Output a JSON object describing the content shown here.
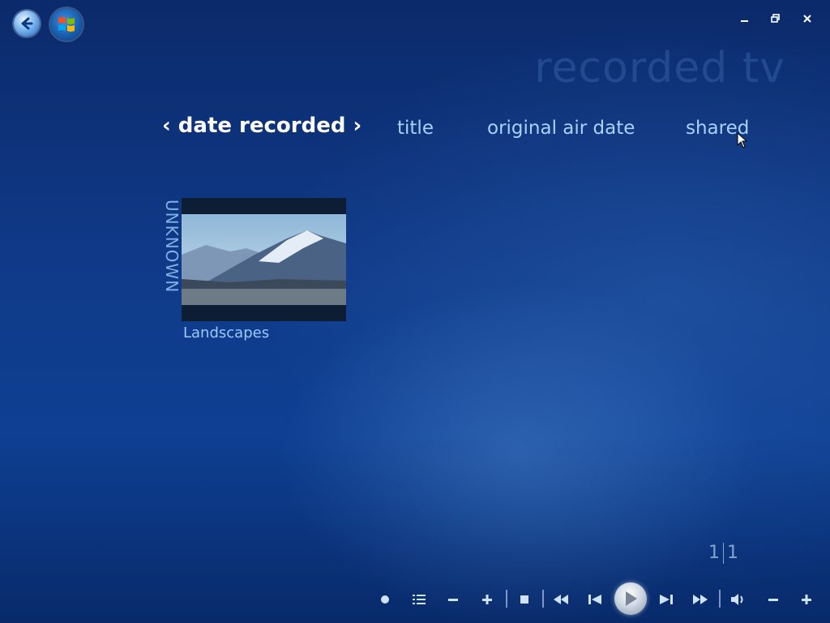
{
  "window": {
    "title": "recorded tv"
  },
  "sort_tabs": [
    {
      "label": "date recorded",
      "active": true
    },
    {
      "label": "title",
      "active": false
    },
    {
      "label": "original air date",
      "active": false
    },
    {
      "label": "shared",
      "active": false
    }
  ],
  "nav": {
    "prev_chevron": "‹",
    "next_chevron": "›"
  },
  "groups": [
    {
      "label": "UNKNOWN",
      "items": [
        {
          "title": "Landscapes"
        }
      ]
    }
  ],
  "pager": {
    "current": "1",
    "total": "1"
  },
  "colors": {
    "accent": "#a9d2ff",
    "active_tab": "#ffffff",
    "background": "#103b8a"
  },
  "icons": {
    "back": "back-arrow-icon",
    "start": "windows-logo-icon",
    "minimize": "minimize-icon",
    "restore": "restore-icon",
    "close": "close-icon"
  }
}
